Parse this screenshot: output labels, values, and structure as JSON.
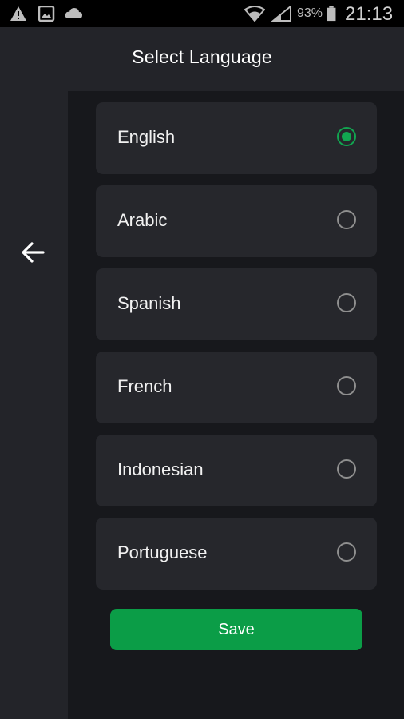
{
  "status_bar": {
    "battery_percent": "93%",
    "time": "21:13",
    "icons": [
      "warning-icon",
      "image-icon",
      "cloud-icon",
      "wifi-icon",
      "signal-icon",
      "battery-icon"
    ]
  },
  "header": {
    "title": "Select Language",
    "back_icon": "arrow-left-icon"
  },
  "languages": [
    {
      "label": "English",
      "selected": true
    },
    {
      "label": "Arabic",
      "selected": false
    },
    {
      "label": "Spanish",
      "selected": false
    },
    {
      "label": "French",
      "selected": false
    },
    {
      "label": "Indonesian",
      "selected": false
    },
    {
      "label": "Portuguese",
      "selected": false
    }
  ],
  "save_button": {
    "label": "Save"
  },
  "colors": {
    "accent": "#11a650",
    "button": "#0b9d47",
    "card": "#26272c",
    "background": "#17181c",
    "header": "#232429"
  }
}
